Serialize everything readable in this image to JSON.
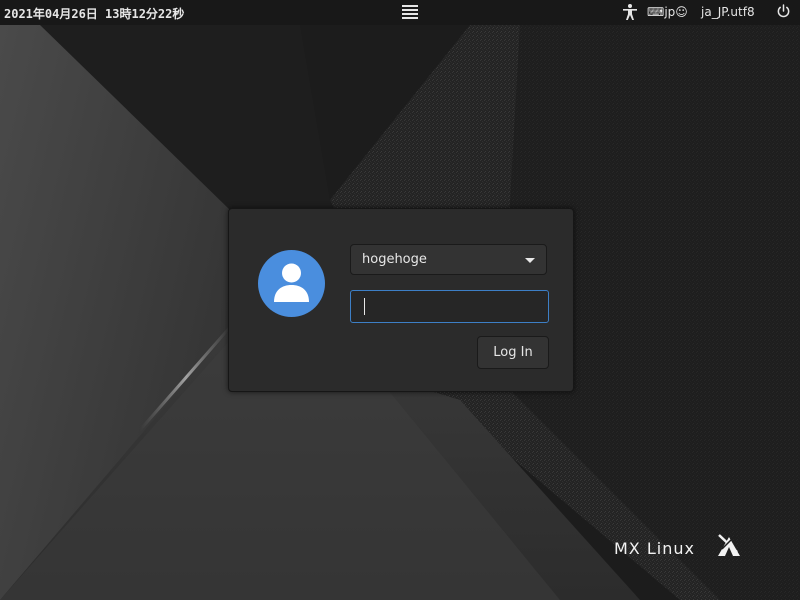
{
  "panel": {
    "clock": "2021年04月26日 13時12分22秒",
    "keyboard_layout": "⌨jp☺",
    "language": "ja_JP.utf8"
  },
  "login": {
    "selected_user": "hogehoge",
    "password_value": "",
    "login_label": "Log In"
  },
  "logo": {
    "text": "MX Linux"
  },
  "icons": {
    "session_menu": "hamburger-menu-icon",
    "accessibility": "accessibility-icon",
    "power": "power-icon",
    "avatar": "user-avatar-icon",
    "dropdown": "chevron-down-icon"
  },
  "colors": {
    "panel_bg": "#181818",
    "dialog_bg": "#2b2b2b",
    "avatar_blue": "#4a8ede",
    "focus_border": "#3d7fc6"
  }
}
